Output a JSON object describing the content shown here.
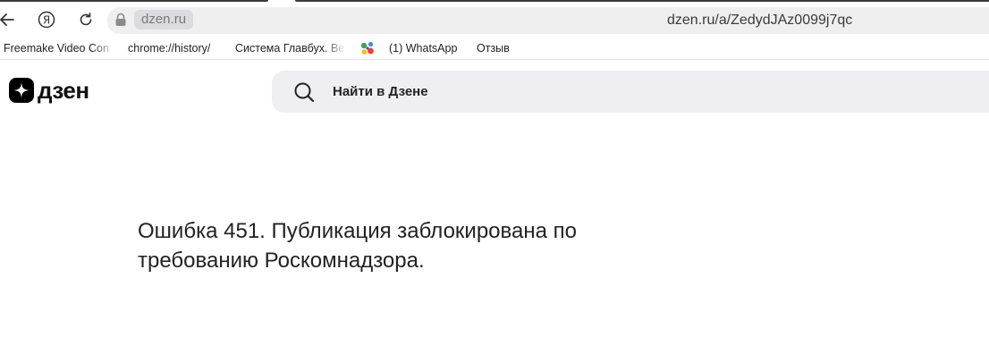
{
  "browser": {
    "domain_chip": "dzen.ru",
    "url": "dzen.ru/a/ZedydJAz0099j7qc",
    "bookmarks": [
      {
        "label": "Freemake Video Con"
      },
      {
        "label": "chrome://history/"
      },
      {
        "label": "Система Главбух. Ве"
      },
      {
        "label": "(1) WhatsApp"
      },
      {
        "label": "Отзыв"
      }
    ],
    "icons": {
      "back": "back-arrow-icon",
      "yandex": "yandex-icon",
      "reload": "reload-icon",
      "lock": "lock-icon",
      "bookmark_app": "colored-dots-icon"
    }
  },
  "header": {
    "logo_text": "дзен",
    "search_placeholder": "Найти в Дзене"
  },
  "main": {
    "error_message": "Ошибка 451. Публикация заблокирована по требованию Роскомнадзора."
  },
  "colors": {
    "omnibox_bg": "#efeff0",
    "search_bg": "#efeff1",
    "text": "#222222",
    "logo_bg": "#000000"
  }
}
